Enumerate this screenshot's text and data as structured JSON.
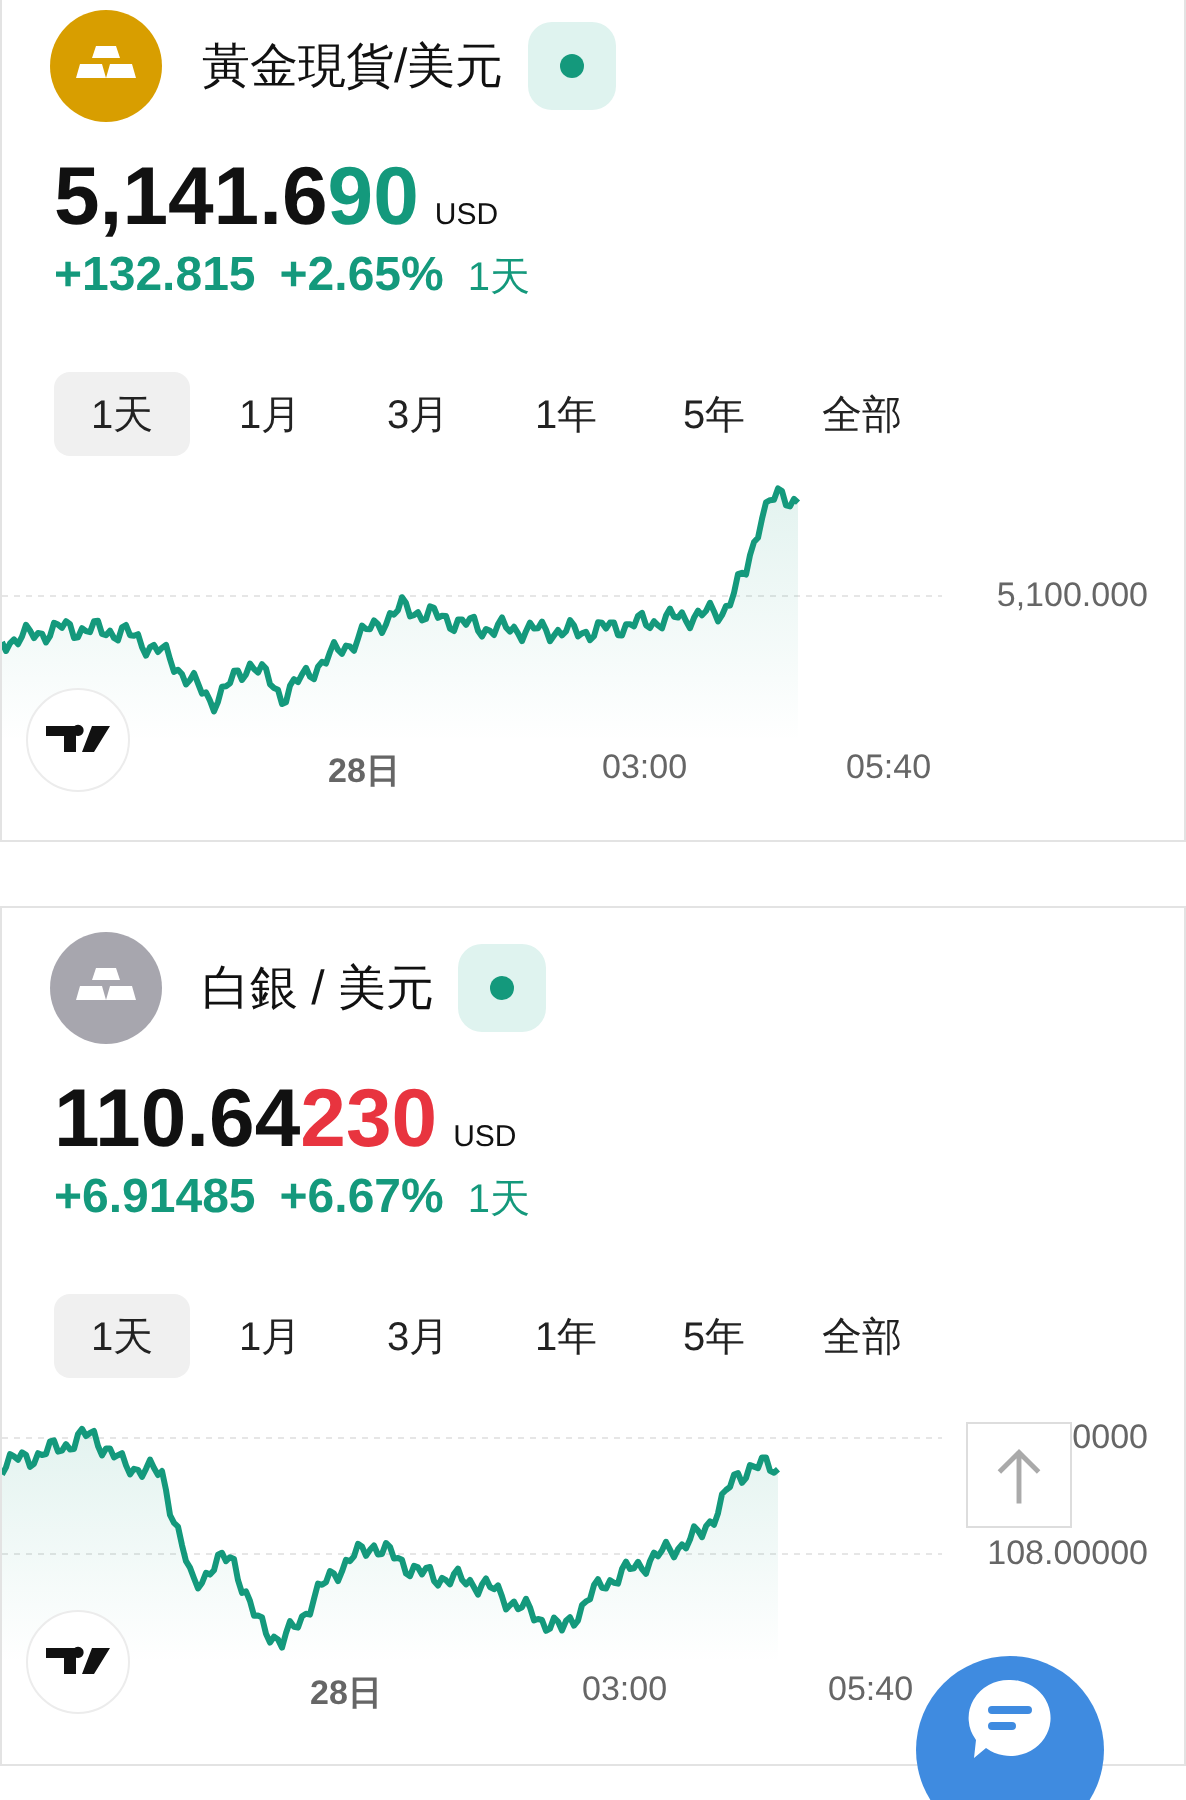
{
  "instruments": [
    {
      "name": "黃金現貨/美元",
      "color": "#d89e00",
      "live": true,
      "price_main": "5,141.6",
      "price_tail": "90",
      "tail_rising": true,
      "currency": "USD",
      "change": "+132.815",
      "change_pct": "+2.65%",
      "period": "1天",
      "tabs": [
        {
          "label": "1天",
          "selected": true
        },
        {
          "label": "1月",
          "selected": false
        },
        {
          "label": "3月",
          "selected": false
        },
        {
          "label": "1年",
          "selected": false
        },
        {
          "label": "5年",
          "selected": false
        },
        {
          "label": "全部",
          "selected": false
        }
      ],
      "chart": {
        "y_labels": [
          "5,100.000"
        ],
        "x_labels": [
          {
            "text": "28日",
            "bold": true
          },
          {
            "text": "03:00",
            "bold": false
          },
          {
            "text": "05:40",
            "bold": false
          }
        ]
      }
    },
    {
      "name": "白銀 / 美元",
      "color": "#a7a6ae",
      "live": true,
      "price_main": "110.64",
      "price_tail": "230",
      "tail_rising": false,
      "currency": "USD",
      "change": "+6.91485",
      "change_pct": "+6.67%",
      "period": "1天",
      "tabs": [
        {
          "label": "1天",
          "selected": true
        },
        {
          "label": "1月",
          "selected": false
        },
        {
          "label": "3月",
          "selected": false
        },
        {
          "label": "1年",
          "selected": false
        },
        {
          "label": "5年",
          "selected": false
        },
        {
          "label": "全部",
          "selected": false
        }
      ],
      "chart": {
        "y_labels": [
          "0000",
          "108.00000"
        ],
        "x_labels": [
          {
            "text": "28日",
            "bold": true
          },
          {
            "text": "03:00",
            "bold": false
          },
          {
            "text": "05:40",
            "bold": false
          }
        ]
      }
    }
  ]
}
